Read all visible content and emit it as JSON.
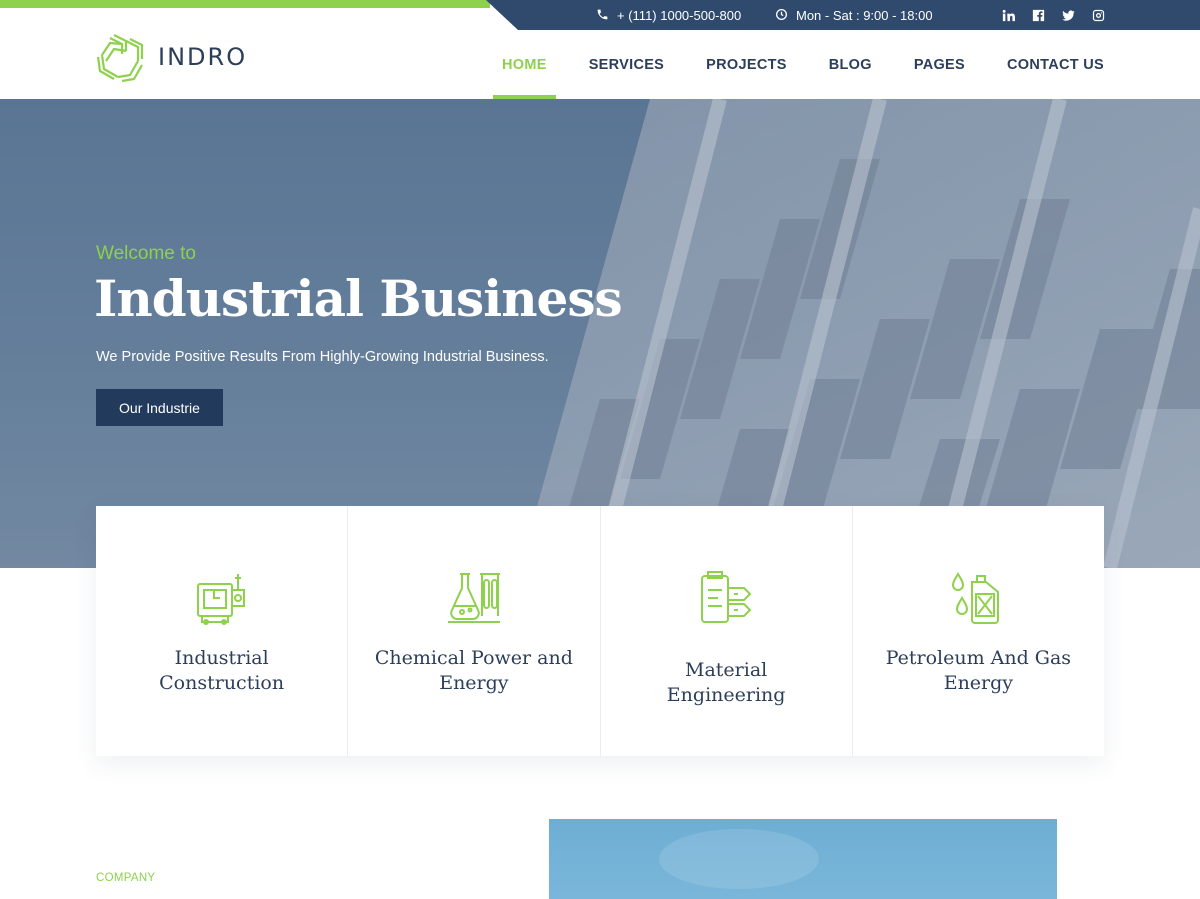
{
  "topbar": {
    "phone": "+ (111) 1000-500-800",
    "hours": "Mon - Sat : 9:00 - 18:00",
    "social": [
      "linkedin-icon",
      "facebook-icon",
      "twitter-icon",
      "instagram-icon"
    ]
  },
  "brand": {
    "name": "INDRO",
    "accent": "#8ed14d",
    "navy": "#2f4a6d"
  },
  "nav": {
    "items": [
      {
        "label": "HOME",
        "active": true
      },
      {
        "label": "SERVICES"
      },
      {
        "label": "PROJECTS"
      },
      {
        "label": "BLOG"
      },
      {
        "label": "PAGES"
      },
      {
        "label": "CONTACT US"
      }
    ]
  },
  "hero": {
    "eyebrow": "Welcome to",
    "title": "Industrial Business",
    "subtitle": "We Provide Positive Results From Highly-Growing Industrial Business.",
    "button": "Our Industrie"
  },
  "features": [
    {
      "title": "Industrial Construction",
      "icon": "machine-icon"
    },
    {
      "title": "Chemical Power and Energy",
      "icon": "flask-icon"
    },
    {
      "title": "Material Engineering",
      "icon": "engineering-icon"
    },
    {
      "title": "Petroleum And Gas Energy",
      "icon": "fuel-can-icon"
    }
  ],
  "company": {
    "label": "COMPANY"
  }
}
